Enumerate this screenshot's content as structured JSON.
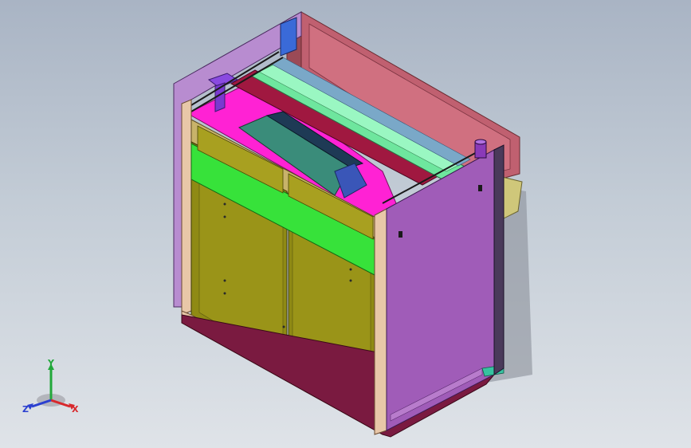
{
  "viewport": {
    "view_name": "isometric-model-view",
    "background_top": "#a9b4c4",
    "background_bottom": "#dfe3e8"
  },
  "triad": {
    "x_label": "X",
    "y_label": "Y",
    "z_label": "Z",
    "x_color": "#d8282c",
    "y_color": "#22a83a",
    "z_color": "#2a3fd0"
  },
  "model": {
    "part_colors": {
      "side_panel": "#a05cb8",
      "top_plate": "#ff22d4",
      "back_panel": "#c06070",
      "doors": "#8f8a14",
      "green_strip": "#37e23a",
      "roller": "#6ee69e",
      "frame": "#e8c7a8",
      "hopper": "#3a8c7a",
      "base": "#7a1a40"
    }
  }
}
